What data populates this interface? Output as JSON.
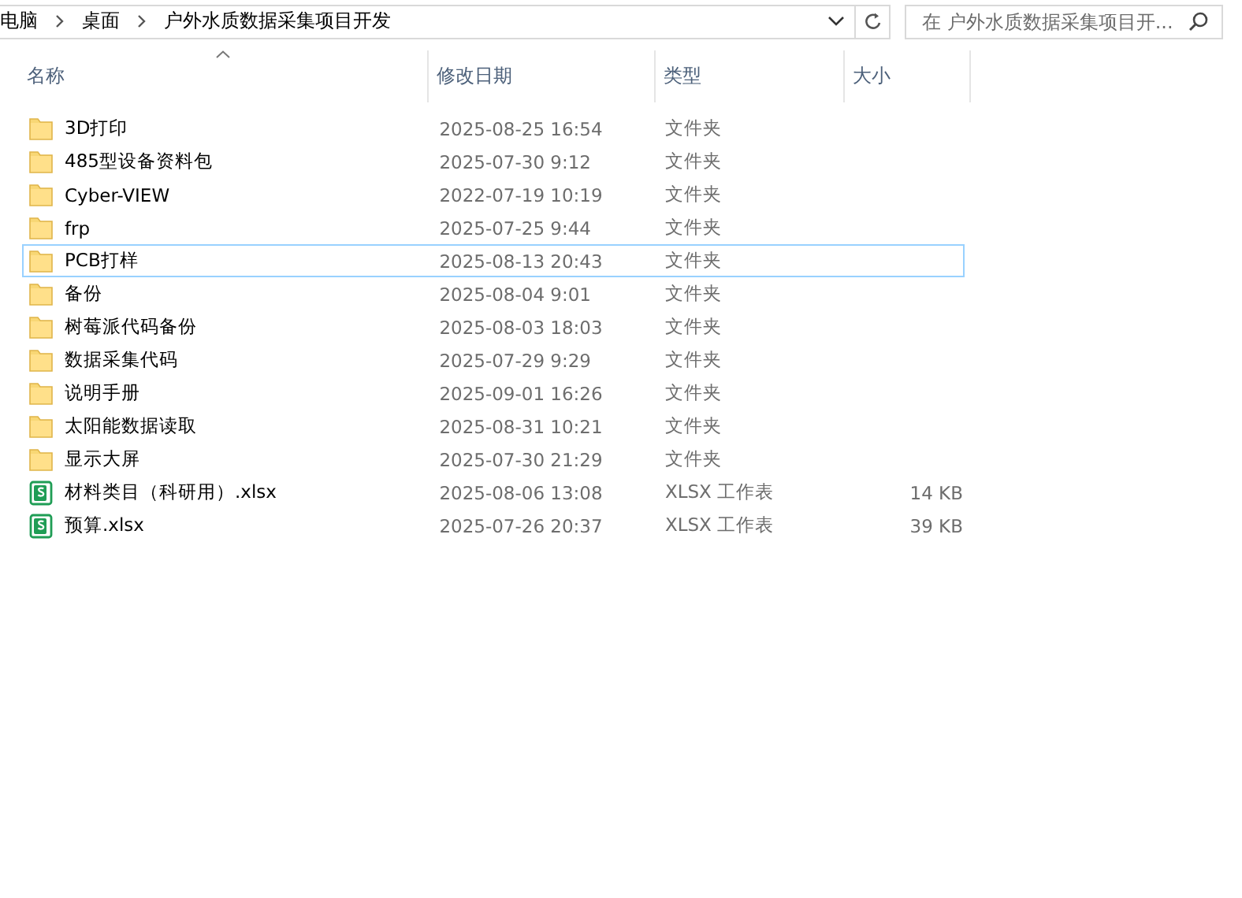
{
  "address_bar": {
    "path": [
      "电脑",
      "桌面",
      "户外水质数据采集项目开发"
    ]
  },
  "search": {
    "placeholder": "在 户外水质数据采集项目开..."
  },
  "columns": [
    {
      "label": "名称",
      "sorted": true
    },
    {
      "label": "修改日期",
      "sorted": false
    },
    {
      "label": "类型",
      "sorted": false
    },
    {
      "label": "大小",
      "sorted": false
    }
  ],
  "rows": [
    {
      "kind": "folder",
      "name": "3D打印",
      "date": "2025-08-25 16:54",
      "type": "文件夹",
      "focused": false
    },
    {
      "kind": "folder",
      "name": "485型设备资料包",
      "date": "2025-07-30 9:12",
      "type": "文件夹",
      "focused": false
    },
    {
      "kind": "folder",
      "name": "Cyber-VIEW",
      "date": "2022-07-19 10:19",
      "type": "文件夹",
      "focused": false
    },
    {
      "kind": "folder",
      "name": "frp",
      "date": "2025-07-25 9:44",
      "type": "文件夹",
      "focused": false
    },
    {
      "kind": "folder",
      "name": "PCB打样",
      "date": "2025-08-13 20:43",
      "type": "文件夹",
      "focused": true
    },
    {
      "kind": "folder",
      "name": "备份",
      "date": "2025-08-04 9:01",
      "type": "文件夹",
      "focused": false
    },
    {
      "kind": "folder",
      "name": "树莓派代码备份",
      "date": "2025-08-03 18:03",
      "type": "文件夹",
      "focused": false
    },
    {
      "kind": "folder",
      "name": "数据采集代码",
      "date": "2025-07-29 9:29",
      "type": "文件夹",
      "focused": false
    },
    {
      "kind": "folder",
      "name": "说明手册",
      "date": "2025-09-01 16:26",
      "type": "文件夹",
      "focused": false
    },
    {
      "kind": "folder",
      "name": "太阳能数据读取",
      "date": "2025-08-31 10:21",
      "type": "文件夹",
      "focused": false
    },
    {
      "kind": "folder",
      "name": "显示大屏",
      "date": "2025-07-30 21:29",
      "type": "文件夹",
      "focused": false
    },
    {
      "kind": "spreadsheet",
      "name": "材料类目（科研用）.xlsx",
      "date": "2025-08-06 13:08",
      "type": "XLSX 工作表",
      "size": "14 KB",
      "focused": false
    },
    {
      "kind": "spreadsheet",
      "name": "预算.xlsx",
      "date": "2025-07-26 20:37",
      "type": "XLSX 工作表",
      "size": "39 KB",
      "focused": false
    }
  ]
}
